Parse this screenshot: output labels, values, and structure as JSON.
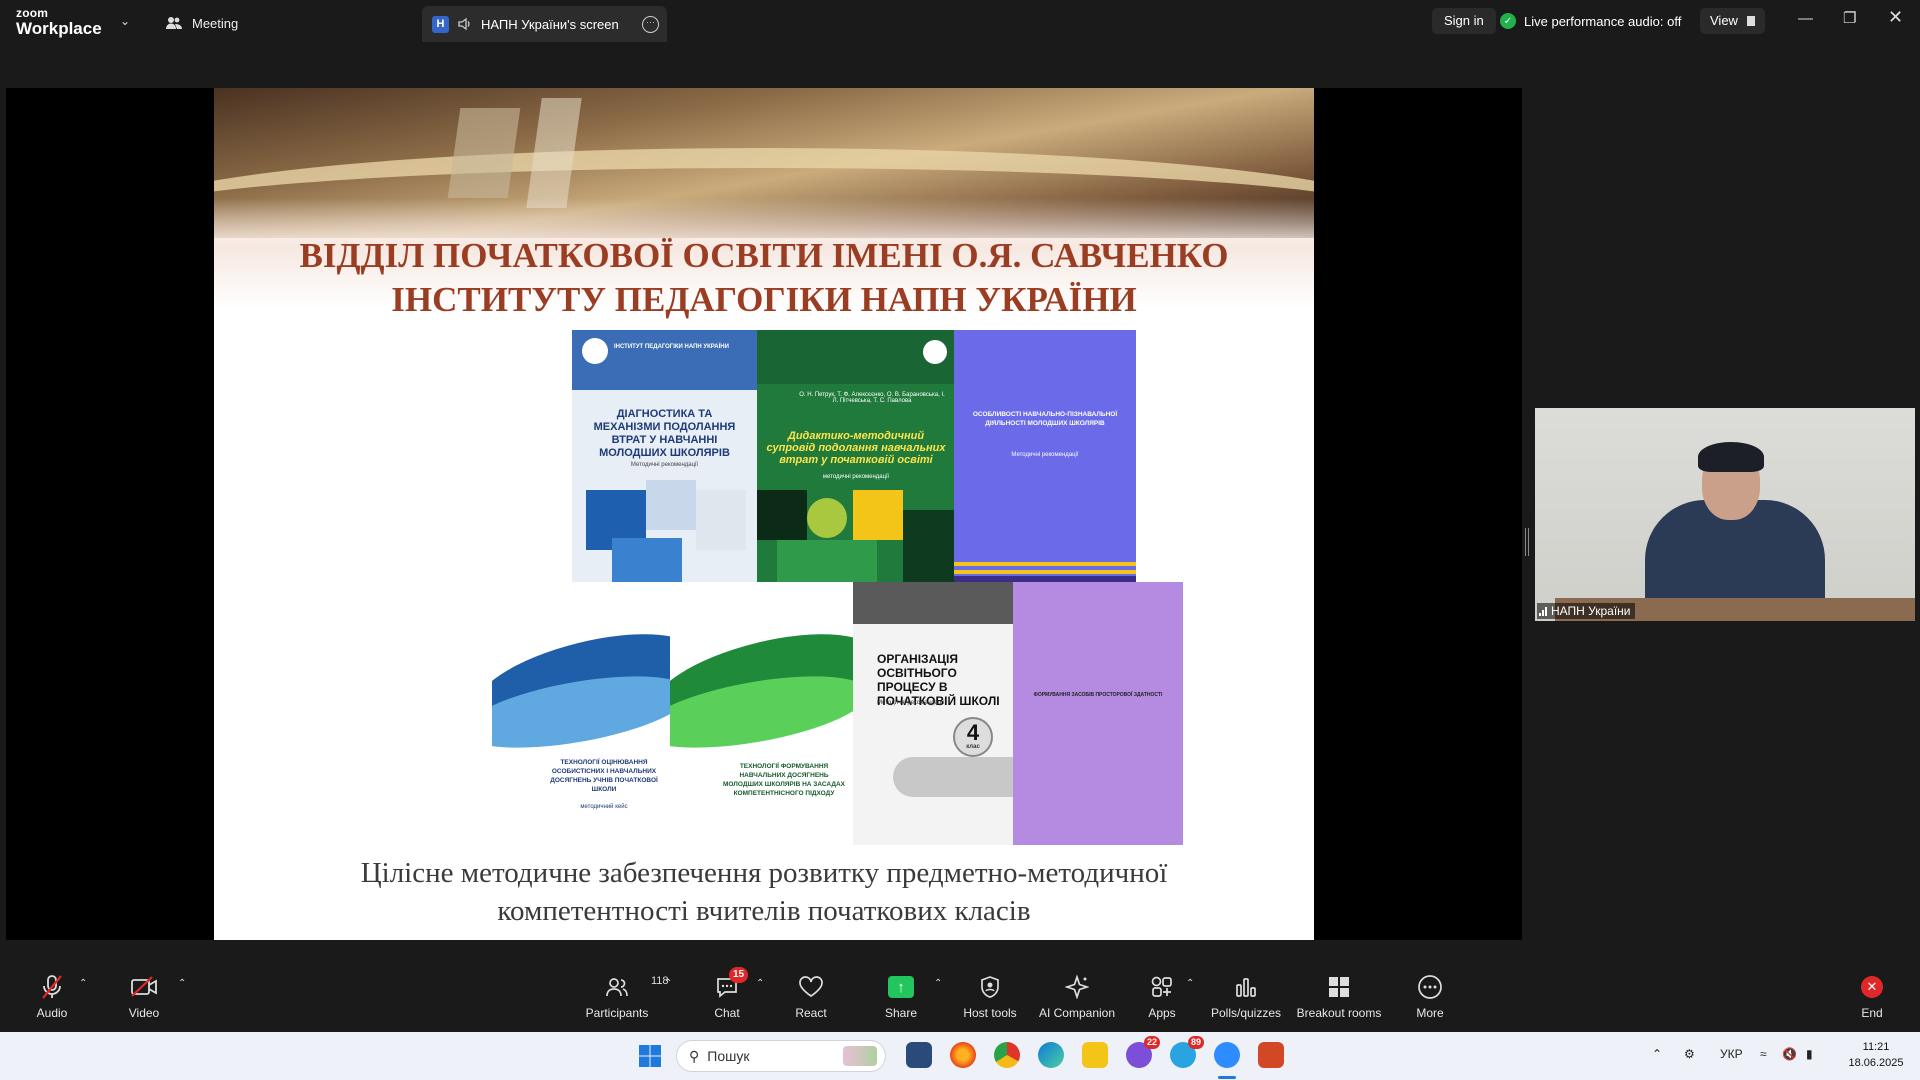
{
  "app": {
    "logo_line1": "zoom",
    "logo_line2": "Workplace",
    "meeting_tab": "Meeting",
    "share_badge": "H",
    "share_tab": "НАПН України's screen",
    "sign_in": "Sign in",
    "live_audio": "Live performance audio: off",
    "view": "View"
  },
  "slide": {
    "title_line1": "ВІДДІЛ ПОЧАТКОВОЇ ОСВІТИ ІМЕНІ О.Я. САВЧЕНКО",
    "title_line2": "ІНСТИТУТУ ПЕДАГОГІКИ НАПН УКРАЇНИ",
    "caption_line1": "Цілісне методичне забезпечення розвитку предметно-методичної",
    "caption_line2": "компетентності вчителів початкових класів",
    "covers": [
      {
        "title": "ДІАГНОСТИКА ТА МЕХАНІЗМИ ПОДОЛАННЯ ВТРАТ У НАВЧАННІ МОЛОДШИХ ШКОЛЯРІВ",
        "subtitle": "Методичні рекомендації",
        "header": "ІНСТИТУТ ПЕДАГОГІКИ НАПН УКРАЇНИ"
      },
      {
        "title": "Дидактико-методичний супровід подолання навчальних втрат у початковій освіті",
        "subtitle": "методичні рекомендації",
        "authors": "О. Н. Петрук, Т. Ф. Алексєєнко, О. В. Барановська, І. Л. Пітчевська, Т. С. Павлова"
      },
      {
        "title": "ОСОБЛИВОСТІ НАВЧАЛЬНО-ПІЗНАВАЛЬНОЇ ДІЯЛЬНОСТІ МОЛОДШИХ ШКОЛЯРІВ",
        "subtitle": "Методичні рекомендації"
      },
      {
        "title": "ТЕХНОЛОГІЇ ОЦІНЮВАННЯ ОСОБИСТІСНИХ І НАВЧАЛЬНИХ ДОСЯГНЕНЬ УЧНІВ ПОЧАТКОВОЇ ШКОЛИ",
        "subtitle": "методичний кейс"
      },
      {
        "title": "ТЕХНОЛОГІЇ ФОРМУВАННЯ НАВЧАЛЬНИХ ДОСЯГНЕНЬ МОЛОДШИХ ШКОЛЯРІВ НА ЗАСАДАХ КОМПЕТЕНТНІСНОГО ПІДХОДУ"
      },
      {
        "title": "ОРГАНІЗАЦІЯ ОСВІТНЬОГО ПРОЦЕСУ В ПОЧАТКОВІЙ ШКОЛІ",
        "subtitle": "Методичні рекомендації",
        "grade": "4",
        "grade_label": "клас"
      },
      {
        "title": "ФОРМУВАННЯ ЗАСОБІВ ПРОСТОРОВОЇ ЗДАТНОСТІ"
      }
    ]
  },
  "participant": {
    "name": "НАПН України"
  },
  "toolbar": {
    "audio": "Audio",
    "video": "Video",
    "participants": "Participants",
    "participants_count": "118",
    "chat": "Chat",
    "chat_badge": "15",
    "react": "React",
    "share": "Share",
    "host_tools": "Host tools",
    "ai_companion": "AI Companion",
    "apps": "Apps",
    "polls": "Polls/quizzes",
    "breakout": "Breakout rooms",
    "more": "More",
    "end": "End"
  },
  "taskbar": {
    "search_placeholder": "Пошук",
    "viber_badge": "22",
    "telegram_badge": "89",
    "lang": "УКР",
    "time": "11:21",
    "date": "18.06.2025"
  },
  "colors": {
    "slide_title": "#9a3d22",
    "share_green": "#22c55e",
    "badge_red": "#e02828"
  }
}
